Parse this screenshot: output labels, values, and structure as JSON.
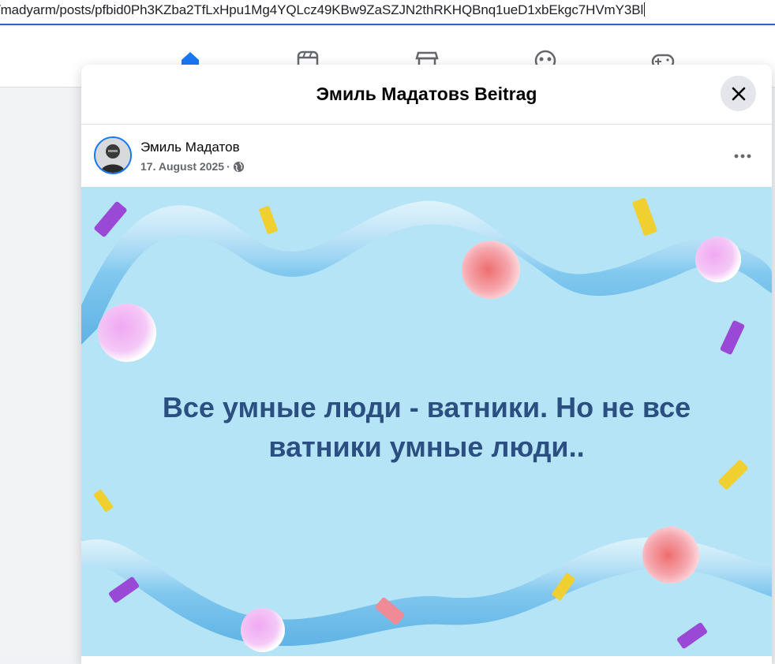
{
  "browser": {
    "url": "/madyarm/posts/pfbid0Ph3KZba2TfLxHpu1Mg4YQLcz49KBw9ZaSZJN2thRKHQBnq1ueD1xbEkgc7HVmY3Bl"
  },
  "nav": {
    "icons": [
      "home-icon",
      "video-icon",
      "marketplace-icon",
      "groups-icon",
      "gaming-icon"
    ]
  },
  "modal": {
    "title": "Эмиль Мадатовs Beitrag"
  },
  "post": {
    "author": "Эмиль Мадатов",
    "date": "17. August 2025",
    "separator": "·",
    "audience_icon": "globe-icon",
    "text": "Все умные люди - ватники. Но не все ватники умные люди.."
  },
  "colors": {
    "accent": "#1877f2",
    "post_background": "#b5e4f6",
    "post_text": "#2c4f82"
  }
}
